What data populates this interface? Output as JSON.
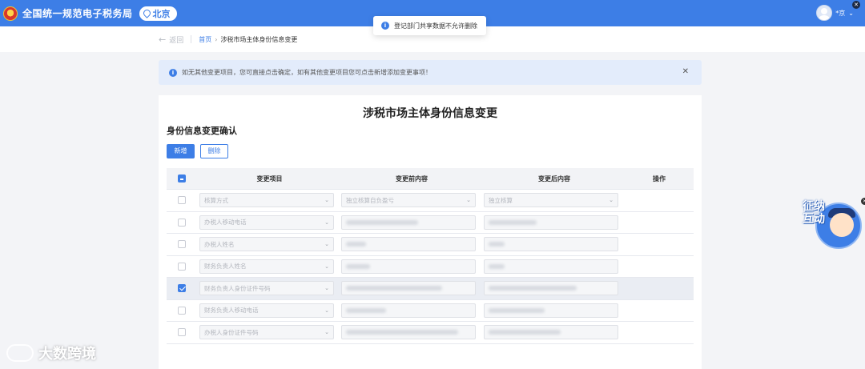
{
  "header": {
    "site_title": "全国统一规范电子税务局",
    "region": "北京",
    "user_name": "*京"
  },
  "toast": {
    "message": "登记部门共享数据不允许删除"
  },
  "breadcrumb": {
    "back": "返回",
    "home": "首页",
    "current": "涉税市场主体身份信息变更"
  },
  "alert": {
    "message": "如无其他变更项目，您可直接点击确定，如有其他变更项目您可点击新增添加变更事项！"
  },
  "page": {
    "title": "涉税市场主体身份信息变更",
    "section_title": "身份信息变更确认",
    "add_label": "新增",
    "delete_label": "删除"
  },
  "table": {
    "headers": {
      "item": "变更项目",
      "before": "变更前内容",
      "after": "变更后内容",
      "action": "操作"
    },
    "rows": [
      {
        "checked": false,
        "item": "核算方式",
        "before": "独立核算自负盈亏",
        "after": "独立核算",
        "before_is_select": true,
        "after_is_select": true
      },
      {
        "checked": false,
        "item": "办税人移动电话",
        "before": "",
        "after": ""
      },
      {
        "checked": false,
        "item": "办税人姓名",
        "before": "",
        "after": ""
      },
      {
        "checked": false,
        "item": "财务负责人姓名",
        "before": "",
        "after": ""
      },
      {
        "checked": true,
        "item": "财务负责人身份证件号码",
        "before": "",
        "after": ""
      },
      {
        "checked": false,
        "item": "财务负责人移动电话",
        "before": "",
        "after": ""
      },
      {
        "checked": false,
        "item": "办税人身份证件号码",
        "before": "",
        "after": ""
      }
    ]
  },
  "mascot": {
    "text": "征纳互动"
  },
  "watermark": {
    "text": "大数跨境"
  },
  "colors": {
    "primary": "#3d7ee6",
    "alert_bg": "#e3ecfb",
    "page_bg": "#f3f4f7"
  }
}
